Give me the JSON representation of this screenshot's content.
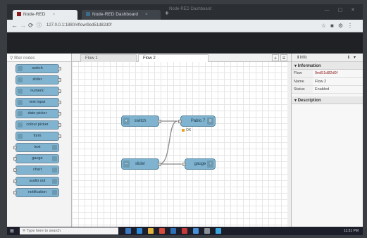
{
  "browser": {
    "window_title": "Node-RED Dashboard",
    "tabs": [
      {
        "label": "Node-RED",
        "active": true
      },
      {
        "label": "Node-RED Dashboard",
        "active": false
      }
    ],
    "new_tab": "+",
    "url": "127.0.0.1:1880/#flow/9ed51d82d0f"
  },
  "palette": {
    "filter_placeholder": "filter nodes",
    "nodes": [
      {
        "label": "switch",
        "icon": "switch-icon"
      },
      {
        "label": "slider",
        "icon": "slider-icon"
      },
      {
        "label": "numeric",
        "icon": "numeric-icon"
      },
      {
        "label": "text input",
        "icon": "text-input-icon"
      },
      {
        "label": "date picker",
        "icon": "calendar-icon"
      },
      {
        "label": "colour picker",
        "icon": "palette-icon"
      },
      {
        "label": "form",
        "icon": "form-icon"
      },
      {
        "label": "text",
        "icon": "text-icon"
      },
      {
        "label": "gauge",
        "icon": "gauge-icon"
      },
      {
        "label": "chart",
        "icon": "chart-icon"
      },
      {
        "label": "audio out",
        "icon": "audio-icon"
      },
      {
        "label": "notification",
        "icon": "bell-icon"
      }
    ]
  },
  "workspace": {
    "tabs": [
      {
        "label": "Flow 1",
        "active": false
      },
      {
        "label": "Flow 2",
        "active": true
      }
    ],
    "add_button": "+",
    "menu_button": "≡",
    "nodes": {
      "switch": {
        "label": "switch"
      },
      "slider": {
        "label": "slider"
      },
      "debug": {
        "label": "Pablo 7"
      },
      "gauge": {
        "label": "gauge"
      }
    },
    "status_text": "OK"
  },
  "sidebar": {
    "tab_label": "info",
    "section_information": "Information",
    "rows": [
      {
        "key": "Flow",
        "value": "9ed51d82d0f",
        "accent": true
      },
      {
        "key": "Name",
        "value": "Flow 2",
        "accent": false
      },
      {
        "key": "Status",
        "value": "Enabled",
        "accent": false
      }
    ],
    "section_description": "Description"
  },
  "taskbar": {
    "search_placeholder": "Type here to search",
    "tray_time": "11:31 PM"
  },
  "colors": {
    "node_fill": "#7fb3cf",
    "accent_red": "#8f1b1b",
    "status_orange": "#e8a21f"
  }
}
